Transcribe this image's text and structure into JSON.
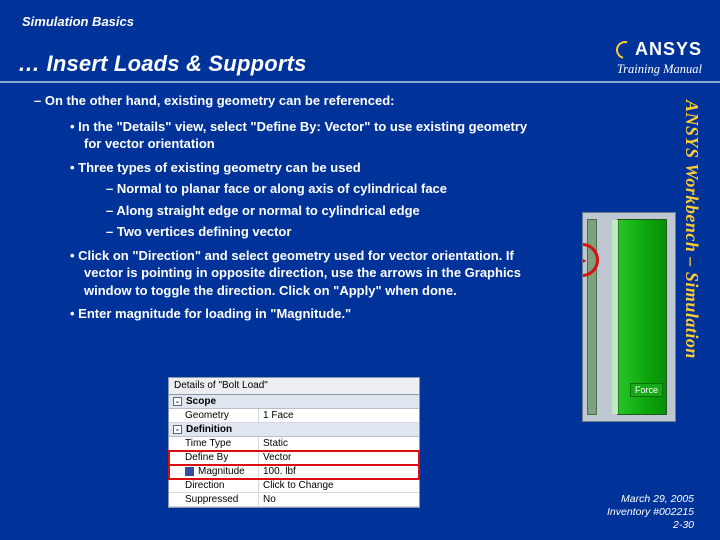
{
  "header": {
    "topic": "Simulation Basics",
    "title": "… Insert Loads & Supports",
    "logo_text": "ANSYS",
    "training_manual": "Training Manual"
  },
  "side_label": "ANSYS Workbench – Simulation",
  "content": {
    "lead": "On the other hand, existing geometry can be referenced:",
    "b1": "In the \"Details\" view, select \"Define By: Vector\" to use existing geometry for vector orientation",
    "b2": "Three types of existing geometry can be used",
    "b2a": "Normal to planar face or along axis of cylindrical face",
    "b2b": "Along straight edge or normal to cylindrical edge",
    "b2c": "Two vertices defining vector",
    "b3": "Click on \"Direction\" and select geometry used for vector orientation. If vector is pointing in opposite direction, use the arrows in the Graphics window to toggle the direction. Click on \"Apply\" when done.",
    "b4": "Enter magnitude for loading in \"Magnitude.\""
  },
  "details_panel": {
    "title": "Details of \"Bolt Load\"",
    "groups": [
      {
        "name": "Scope",
        "rows": [
          {
            "k": "Geometry",
            "v": "1 Face"
          }
        ]
      },
      {
        "name": "Definition",
        "rows": [
          {
            "k": "Time Type",
            "v": "Static"
          },
          {
            "k": "Define By",
            "v": "Vector",
            "highlight": true
          },
          {
            "k": "Magnitude",
            "v": "100. lbf",
            "highlight": true,
            "square": true
          },
          {
            "k": "Direction",
            "v": "Click to Change"
          },
          {
            "k": "Suppressed",
            "v": "No"
          }
        ]
      }
    ]
  },
  "mini": {
    "tag": "Force"
  },
  "footer": {
    "date": "March 29, 2005",
    "inventory": "Inventory #002215",
    "page": "2-30"
  }
}
